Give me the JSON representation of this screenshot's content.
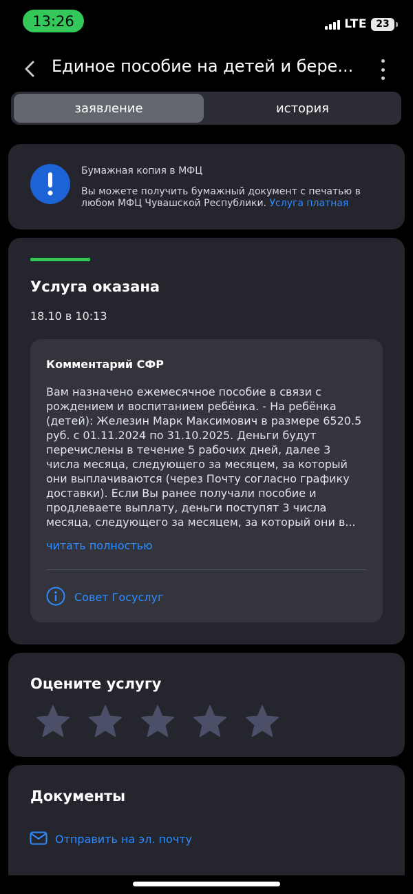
{
  "status_bar": {
    "time": "13:26",
    "network": "LTE",
    "battery": "23"
  },
  "header": {
    "title": "Единое пособие на детей и бере..."
  },
  "tabs": [
    {
      "label": "заявление",
      "active": true
    },
    {
      "label": "история",
      "active": false
    }
  ],
  "mfc_notice": {
    "title": "Бумажная копия в МФЦ",
    "text": "Вы можете получить бумажный документ с печатью в любом МФЦ Чувашской Республики.",
    "link": "Услуга платная"
  },
  "status": {
    "title": "Услуга оказана",
    "date": "18.10 в 10:13",
    "accent_color": "#34c759"
  },
  "comment": {
    "title": "Комментарий СФР",
    "text": "Вам назначено ежемесячное пособие в связи с рождением и воспитанием ребёнка. - На ребёнка (детей): Железин Марк Максимович в размере 6520.5 руб. с 01.11.2024 по 31.10.2025. Деньги будут перечислены в течение 5 рабочих дней, далее 3 числа месяца, следующего за месяцем, за который они выплачиваются (через Почту согласно графику доставки). Если Вы ранее получали пособие и продлеваете выплату, деньги поступят 3 числа месяца, следующего за месяцем, за который они в...",
    "read_more": "читать полностью",
    "advice": "Совет Госуслуг"
  },
  "rating": {
    "title": "Оцените услугу",
    "stars_total": 5,
    "stars_selected": 0
  },
  "documents": {
    "title": "Документы",
    "send_email": "Отправить на эл. почту"
  },
  "colors": {
    "accent": "#2f8cff",
    "card": "#25262d",
    "info_icon_bg": "#1e63d6"
  },
  "icons": [
    "back-chevron-icon",
    "more-vertical-icon",
    "exclamation-icon",
    "info-icon",
    "star-icon",
    "mail-icon"
  ]
}
